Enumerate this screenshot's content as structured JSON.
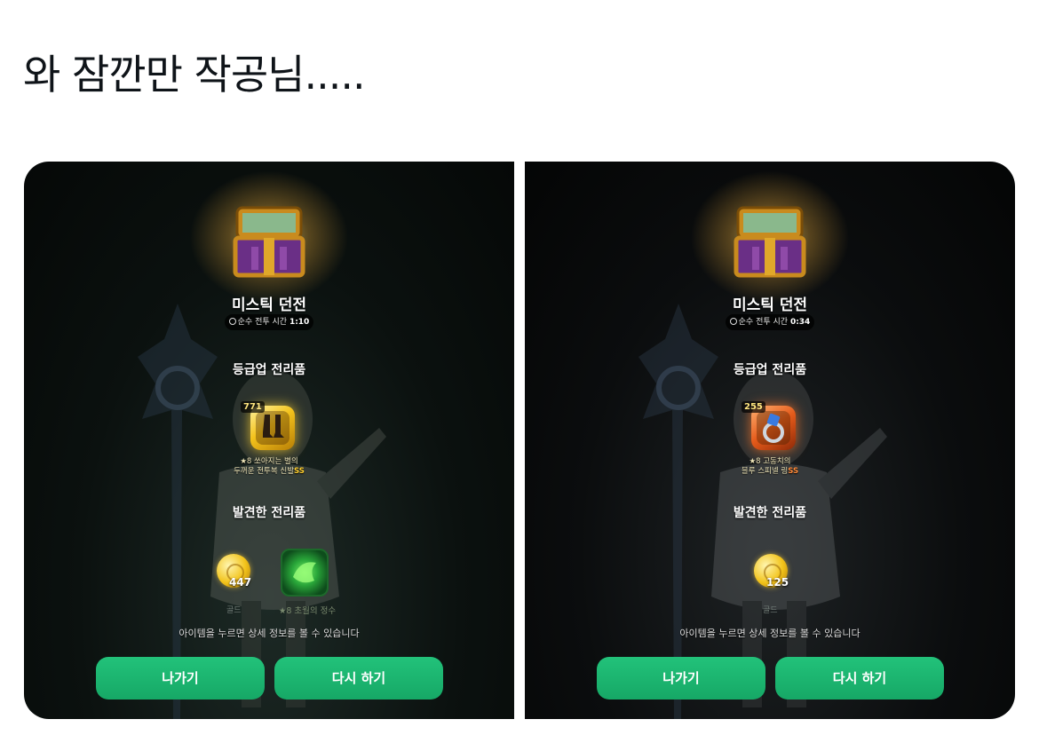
{
  "post": {
    "title": "와 잠깐만 작공님....."
  },
  "panels": [
    {
      "dungeon_name": "미스틱 던전",
      "time_label": "순수 전투 시간",
      "time_value": "1:10",
      "upgrade_title": "등급업 전리품",
      "upgrade_item": {
        "count": "771",
        "desc_line1": "★8 쏘아지는 별의",
        "desc_line2": "두꺼운 전투복 신발",
        "grade": "SS",
        "color": "#f3c21c"
      },
      "found_title": "발견한 전리품",
      "gold": {
        "amount": "447",
        "label": "골드"
      },
      "essence": {
        "label": "★8 초월의 정수"
      },
      "hint": "아이템을 누르면 상세 정보를 볼 수 있습니다",
      "exit_label": "나가기",
      "retry_label": "다시 하기"
    },
    {
      "dungeon_name": "미스틱 던전",
      "time_label": "순수 전투 시간",
      "time_value": "0:34",
      "upgrade_title": "등급업 전리품",
      "upgrade_item": {
        "count": "255",
        "desc_line1": "★8 고동치의",
        "desc_line2": "블루 스피넬 링",
        "grade": "SS",
        "color": "#e45a1a"
      },
      "found_title": "발견한 전리품",
      "gold": {
        "amount": "125",
        "label": "골드"
      },
      "hint": "아이템을 누르면 상세 정보를 볼 수 있습니다",
      "exit_label": "나가기",
      "retry_label": "다시 하기"
    }
  ]
}
